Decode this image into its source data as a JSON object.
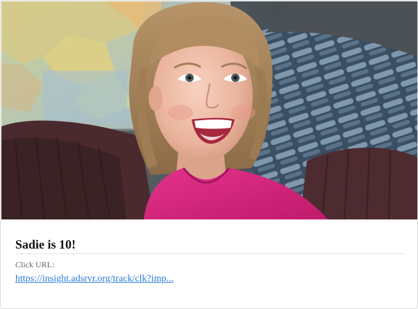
{
  "card": {
    "title": "Sadie is 10!",
    "click_url_label": "Click URL:",
    "click_url": "https://insight.adsrvr.org/track/clk?imp..."
  },
  "image": {
    "alt": "Smiling girl in a pink shirt in front of a map"
  },
  "colors": {
    "link": "#2a7bd6",
    "shirt": "#d9237e",
    "title": "#111111"
  }
}
